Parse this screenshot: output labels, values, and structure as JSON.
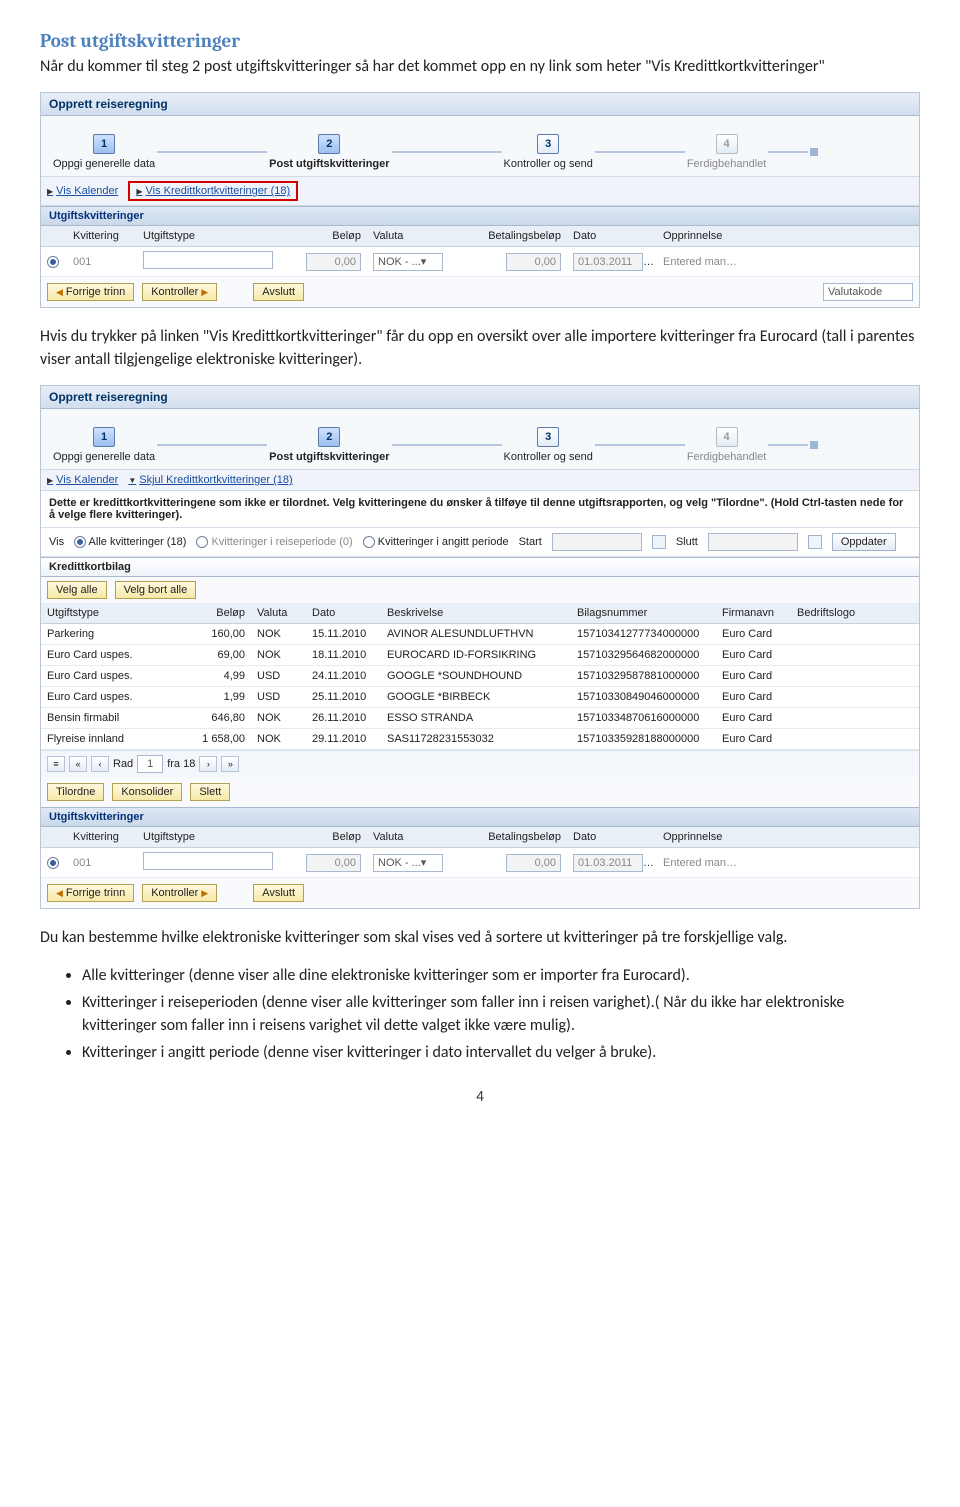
{
  "heading": "Post utgiftskvitteringer",
  "intro1": "Når du kommer til steg 2 post utgiftskvitteringer så har det kommet opp en ny link som heter \"Vis Kredittkortkvitteringer\"",
  "intro2": "Hvis du trykker på linken \"Vis Kredittkortkvitteringer\" får du opp en oversikt over alle importere kvitteringer fra Eurocard (tall i parentes viser antall tilgjengelige elektroniske kvitteringer).",
  "intro3": "Du kan bestemme hvilke elektroniske kvitteringer som skal vises ved å sortere ut kvitteringer på tre forskjellige valg.",
  "bullets": [
    "Alle kvitteringer (denne viser alle dine elektroniske kvitteringer som er importer fra Eurocard).",
    "Kvitteringer i reiseperioden (denne viser alle kvitteringer som faller inn i reisen varighet).( Når du ikke har elektroniske kvitteringer som faller inn i reisens varighet vil dette valget ikke være mulig).",
    "Kvitteringer i angitt periode (denne viser kvitteringer i dato intervallet du velger å bruke)."
  ],
  "page_number": "4",
  "app1": {
    "title": "Opprett reiseregning",
    "steps": [
      {
        "num": "1",
        "label": "Oppgi generelle data",
        "active": true
      },
      {
        "num": "2",
        "label": "Post utgiftskvitteringer",
        "active": true,
        "bold": true
      },
      {
        "num": "3",
        "label": "Kontroller og send",
        "active": false
      },
      {
        "num": "4",
        "label": "Ferdigbehandlet",
        "active": false
      }
    ],
    "link_calendar": "Vis Kalender",
    "link_cc": "Vis Kredittkortkvitteringer (18)",
    "section_receipts": "Utgiftskvitteringer",
    "head": {
      "kvittering": "Kvittering",
      "utgiftstype": "Utgiftstype",
      "belop": "Beløp",
      "valuta": "Valuta",
      "betalingsbelop": "Betalingsbeløp",
      "dato": "Dato",
      "opprinnelse": "Opprinnelse"
    },
    "row": {
      "id": "001",
      "type": "",
      "belop": "0,00",
      "valuta": "NOK - ...",
      "bet": "0,00",
      "dato": "01.03.2011",
      "opprinnelse": "Entered manually"
    },
    "btn_prev": "Forrige trinn",
    "btn_check": "Kontroller",
    "btn_exit": "Avslutt",
    "valutakode": "Valutakode"
  },
  "app2": {
    "title": "Opprett reiseregning",
    "link_calendar": "Vis Kalender",
    "link_cc": "Skjul Kredittkortkvitteringer (18)",
    "note": "Dette er kredittkortkvitteringene som ikke er tilordnet. Velg kvitteringene du ønsker å tilføye til denne utgiftsrapporten, og velg \"Tilordne\". (Hold Ctrl-tasten nede for å velge flere kvitteringer).",
    "filter": {
      "vis": "Vis",
      "opt_all": "Alle kvitteringer  (18)",
      "opt_period": "Kvitteringer i reiseperiode (0)",
      "opt_range": "Kvitteringer i angitt periode",
      "start": "Start",
      "slutt": "Slutt",
      "oppdater": "Oppdater"
    },
    "section_bilag": "Kredittkortbilag",
    "btn_select_all": "Velg alle",
    "btn_deselect_all": "Velg bort alle",
    "bhead": {
      "utgiftstype": "Utgiftstype",
      "belop": "Beløp",
      "valuta": "Valuta",
      "dato": "Dato",
      "beskrivelse": "Beskrivelse",
      "bilagsnummer": "Bilagsnummer",
      "firmanavn": "Firmanavn",
      "bedriftslogo": "Bedriftslogo"
    },
    "brows": [
      {
        "type": "Parkering",
        "belop": "160,00",
        "val": "NOK",
        "dato": "15.11.2010",
        "besk": "AVINOR ALESUNDLUFTHVN",
        "bilag": "15710341277734000000",
        "firma": "Euro Card"
      },
      {
        "type": "Euro Card uspes.",
        "belop": "69,00",
        "val": "NOK",
        "dato": "18.11.2010",
        "besk": "EUROCARD ID-FORSIKRING",
        "bilag": "15710329564682000000",
        "firma": "Euro Card"
      },
      {
        "type": "Euro Card uspes.",
        "belop": "4,99",
        "val": "USD",
        "dato": "24.11.2010",
        "besk": "GOOGLE *SOUNDHOUND",
        "bilag": "15710329587881000000",
        "firma": "Euro Card"
      },
      {
        "type": "Euro Card uspes.",
        "belop": "1,99",
        "val": "USD",
        "dato": "25.11.2010",
        "besk": "GOOGLE *BIRBECK",
        "bilag": "15710330849046000000",
        "firma": "Euro Card"
      },
      {
        "type": "Bensin  firmabil",
        "belop": "646,80",
        "val": "NOK",
        "dato": "26.11.2010",
        "besk": "ESSO STRANDA",
        "bilag": "15710334870616000000",
        "firma": "Euro Card"
      },
      {
        "type": "Flyreise innland",
        "belop": "1 658,00",
        "val": "NOK",
        "dato": "29.11.2010",
        "besk": "SAS11728231553032",
        "bilag": "15710335928188000000",
        "firma": "Euro Card"
      }
    ],
    "pager": {
      "rad": "Rad",
      "rownum": "1",
      "fra": "fra 18"
    },
    "btn_tilordne": "Tilordne",
    "btn_konsolider": "Konsolider",
    "btn_slett": "Slett",
    "section_receipts": "Utgiftskvitteringer",
    "row": {
      "id": "001",
      "belop": "0,00",
      "valuta": "NOK - ...",
      "bet": "0,00",
      "dato": "01.03.2011",
      "opprinnelse": "Entered manually"
    },
    "btn_prev": "Forrige trinn",
    "btn_check": "Kontroller",
    "btn_exit": "Avslutt"
  }
}
